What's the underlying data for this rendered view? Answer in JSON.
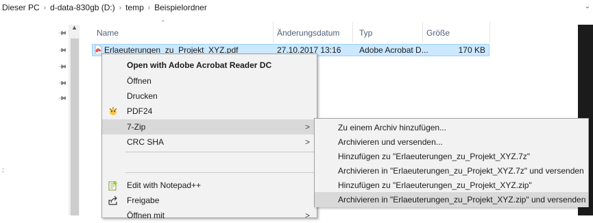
{
  "breadcrumb": {
    "items": [
      "Dieser PC",
      "d-data-830gb (D:)",
      "temp",
      "Beispielordner"
    ],
    "separator": "›"
  },
  "columns": {
    "name": "Name",
    "date": "Änderungsdatum",
    "type": "Typ",
    "size": "Größe"
  },
  "file": {
    "name": "Erlaeuterungen_zu_Projekt_XYZ.pdf",
    "date": "27.10.2017 13:16",
    "type": "Adobe Acrobat D...",
    "size": "170 KB"
  },
  "context_menu": {
    "items": [
      {
        "label": "Open with Adobe Acrobat Reader DC",
        "bold": true
      },
      {
        "label": "Öffnen"
      },
      {
        "label": "Drucken"
      },
      {
        "label": "PDF24",
        "icon": "pdf24-icon"
      },
      {
        "label": "7-Zip",
        "submenu": true,
        "highlighted": true
      },
      {
        "label": "CRC SHA",
        "submenu": true
      },
      {
        "label": "Edit with Notepad++",
        "icon": "notepadpp-icon"
      },
      {
        "label": "Freigabe",
        "icon": "share-icon"
      },
      {
        "label": "Öffnen mit",
        "submenu": true
      }
    ]
  },
  "submenu_7zip": {
    "items": [
      "Zu einem Archiv hinzufügen...",
      "Archivieren und versenden...",
      "Hinzufügen zu \"Erlaeuterungen_zu_Projekt_XYZ.7z\"",
      "Archivieren in \"Erlaeuterungen_zu_Projekt_XYZ.7z\" und versenden",
      "Hinzufügen zu \"Erlaeuterungen_zu_Projekt_XYZ.zip\"",
      "Archivieren in \"Erlaeuterungen_zu_Projekt_XYZ.zip\" und versenden"
    ],
    "highlighted_index": 5
  },
  "colors": {
    "selection": "#cce8ff",
    "selection_border": "#99d1ff",
    "menu_bg": "#f2f2f2",
    "menu_highlight": "#d9d9d9",
    "column_header_text": "#4c607a"
  }
}
